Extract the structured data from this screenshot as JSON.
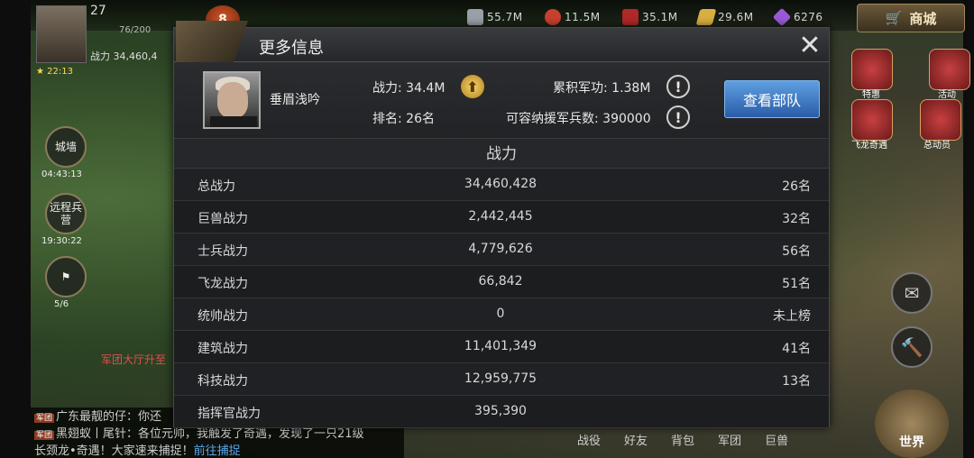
{
  "hud": {
    "player_level": "27",
    "energy": "76/200",
    "power_label": "战力",
    "power_value": "34,460,4",
    "timer": "22:13",
    "vip_level": "8",
    "resources": [
      {
        "name": "steel",
        "icon": "steel-icon",
        "value": "55.7M",
        "color": "#9aa0a8"
      },
      {
        "name": "food",
        "icon": "food-icon",
        "value": "11.5M",
        "color": "#c84030"
      },
      {
        "name": "oil",
        "icon": "oil-icon",
        "value": "35.1M",
        "color": "#b02828"
      },
      {
        "name": "gold",
        "icon": "gold-icon",
        "value": "29.6M",
        "color": "#d8b040"
      },
      {
        "name": "diamond",
        "icon": "diamond-icon",
        "value": "6276",
        "color": "#9a5ad8"
      }
    ],
    "shop_label": "商城"
  },
  "side": {
    "wall_label": "城墙",
    "wall_time": "04:43:13",
    "barracks_label": "远程兵营",
    "barracks_time": "19:30:22",
    "flag_count": "5/6",
    "notice": "军团大厅升至"
  },
  "right_icons": {
    "special_label": "特惠",
    "event_label": "活动",
    "flying_label": "飞龙奇遇",
    "mobilize_label": "总动员"
  },
  "chat": {
    "tag": "军团",
    "line1": "广东最靓的仔：你还",
    "line2": "黑翅蚁丨尾针：各位元帅，我触发了奇遇，发现了一只21级",
    "line3": "长颈龙•奇遇！大家速来捕捉！",
    "line3_link": "前往捕捉"
  },
  "bottom_nav": [
    "战役",
    "好友",
    "背包",
    "军团",
    "巨兽"
  ],
  "world_label": "世界",
  "dialog": {
    "title": "更多信息",
    "player_name": "垂眉浅吟",
    "power_label": "战力: 34.4M",
    "rank_label": "排名: 26名",
    "merit_label": "累积军功: 1.38M",
    "reinforce_label": "可容纳援军兵数: 390000",
    "view_army_label": "查看部队",
    "section_title": "战力",
    "rows": [
      {
        "label": "总战力",
        "value": "34,460,428",
        "rank": "26名"
      },
      {
        "label": "巨兽战力",
        "value": "2,442,445",
        "rank": "32名"
      },
      {
        "label": "士兵战力",
        "value": "4,779,626",
        "rank": "56名"
      },
      {
        "label": "飞龙战力",
        "value": "66,842",
        "rank": "51名"
      },
      {
        "label": "统帅战力",
        "value": "0",
        "rank": "未上榜"
      },
      {
        "label": "建筑战力",
        "value": "11,401,349",
        "rank": "41名"
      },
      {
        "label": "科技战力",
        "value": "12,959,775",
        "rank": "13名"
      },
      {
        "label": "指挥官战力",
        "value": "395,390",
        "rank": ""
      }
    ]
  }
}
